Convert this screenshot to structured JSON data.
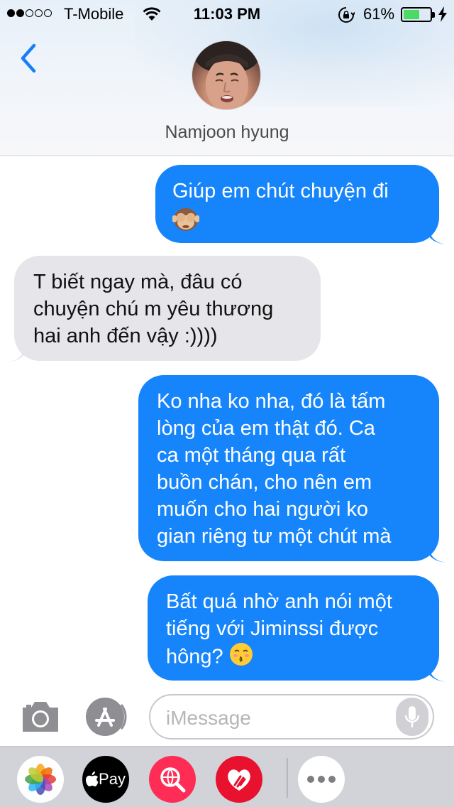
{
  "status_bar": {
    "signal_dots_filled": 2,
    "signal_dots_total": 5,
    "carrier": "T-Mobile",
    "time": "11:03 PM",
    "battery_percent": "61%",
    "battery_level": 0.61,
    "icons": [
      "wifi-icon",
      "orientation-lock-icon",
      "battery-icon",
      "charging-bolt-icon"
    ]
  },
  "header": {
    "back_icon": "chevron-left-icon",
    "contact_name": "Namjoon hyung",
    "avatar": "contact-avatar-photo"
  },
  "messages": [
    {
      "direction": "sent",
      "lines": [
        "Giúp em chút chuyện đi"
      ],
      "emoji": "see-no-evil-monkey-emoji"
    },
    {
      "direction": "received",
      "lines": [
        "T biết ngay mà, đâu có",
        "chuyện chú m yêu thương",
        "hai anh đến vậy :))))"
      ]
    },
    {
      "direction": "sent",
      "lines": [
        "Ko nha ko nha, đó là tấm",
        "lòng của em thật đó. Ca",
        "ca một tháng qua rất",
        "buồn chán, cho nên em",
        "muốn cho hai người ko",
        "gian riêng tư một chút mà"
      ]
    },
    {
      "direction": "sent",
      "lines": [
        "Bất quá nhờ anh nói một",
        "tiếng với Jiminssi được",
        "hông?"
      ],
      "emoji": "kissing-face-emoji"
    }
  ],
  "input_bar": {
    "placeholder": "iMessage",
    "icons": [
      "camera-icon",
      "app-store-icon",
      "microphone-icon"
    ]
  },
  "app_drawer": {
    "apps": [
      {
        "name": "Photos",
        "icon": "photos-icon"
      },
      {
        "name": "Apple Pay",
        "label": "Pay",
        "icon": "apple-logo-icon"
      },
      {
        "name": "Image search",
        "icon": "globe-search-icon"
      },
      {
        "name": "Digital Touch",
        "icon": "heart-hands-icon"
      },
      {
        "name": "More",
        "icon": "more-dots-icon"
      }
    ]
  },
  "colors": {
    "sent_bubble": "#1685fb",
    "received_bubble": "#e5e5ea",
    "accent_blue": "#157efb",
    "battery_green": "#4cd964"
  }
}
